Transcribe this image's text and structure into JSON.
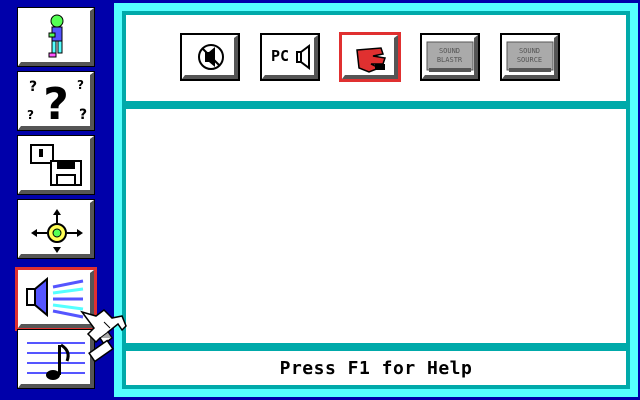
{
  "sidebar": {
    "items": [
      {
        "icon": "character-icon"
      },
      {
        "icon": "help-question-icon"
      },
      {
        "icon": "disk-save-icon"
      },
      {
        "icon": "joystick-control-icon"
      },
      {
        "icon": "sound-speaker-icon",
        "active": true
      },
      {
        "icon": "music-note-icon"
      }
    ]
  },
  "toolbar": {
    "buttons": [
      {
        "icon": "sound-off-icon"
      },
      {
        "label": "PC",
        "icon": "pc-speaker-icon"
      },
      {
        "icon": "adlib-hand-icon",
        "selected": true
      },
      {
        "text": [
          "SOUND",
          "BLASTR"
        ],
        "icon": "sound-blaster-card-icon"
      },
      {
        "text": [
          "SOUND",
          "SOURCE"
        ],
        "icon": "sound-source-card-icon"
      }
    ]
  },
  "status": {
    "text": "Press F1 for Help"
  },
  "colors": {
    "background": "#0000aa",
    "panel_border": "#55ffff",
    "panel_inner": "#00aaaa",
    "selection": "#e03030"
  }
}
